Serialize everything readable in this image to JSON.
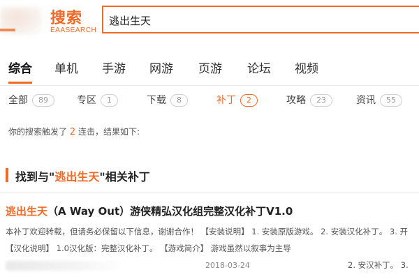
{
  "header": {
    "brand_cn": "搜索",
    "brand_en": "EAASEARCH",
    "search": {
      "value": "逃出生天"
    }
  },
  "main_tabs": [
    {
      "label": "综合",
      "active": true
    },
    {
      "label": "单机"
    },
    {
      "label": "手游"
    },
    {
      "label": "网游"
    },
    {
      "label": "页游"
    },
    {
      "label": "论坛"
    },
    {
      "label": "视频"
    }
  ],
  "sub_tabs": [
    {
      "label": "全部",
      "count": "89"
    },
    {
      "label": "专区",
      "count": "1"
    },
    {
      "label": "下载",
      "count": "8"
    },
    {
      "label": "补丁",
      "count": "2",
      "active": true
    },
    {
      "label": "攻略",
      "count": "23"
    },
    {
      "label": "资讯",
      "count": "55"
    }
  ],
  "notice": {
    "prefix": "你的搜索触发了",
    "number": "2",
    "suffix": "连击，结果如下:"
  },
  "section": {
    "prefix": "找到与\"",
    "keyword": "逃出生天",
    "suffix": "\"相关补丁"
  },
  "result": {
    "title_highlight": "逃出生天",
    "title_rest": "（A Way Out）游侠精弘汉化组完整汉化补丁V1.0",
    "desc_line1": "本补丁欢迎转载，但请务必保留以下信息，谢谢合作！ 【安装说明】 1. 安装原版游戏。 2. 安装汉化补丁。 3. 开",
    "desc_line2": "【汉化说明】 1.0汉化版：完整汉化补丁。 【游戏简介】 游戏虽然以叙事为主导",
    "date": "2018-03-24",
    "extra": "2. 安汉补丁。 3."
  },
  "colors": {
    "accent": "#f06a25"
  }
}
